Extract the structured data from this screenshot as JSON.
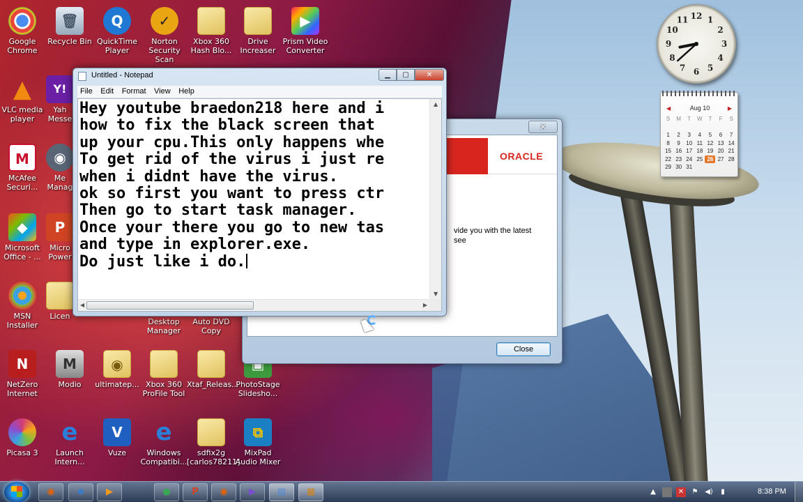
{
  "desktop": {
    "icons": [
      {
        "label": "Google Chrome",
        "icon": "chrome-icon",
        "glyph": "●",
        "color": "#e8453c"
      },
      {
        "label": "Recycle Bin",
        "icon": "recycle-bin-icon",
        "glyph": "🗑",
        "color": "#aab7c6"
      },
      {
        "label": "QuickTime Player",
        "icon": "quicktime-icon",
        "glyph": "Q",
        "color": "#1e78d4"
      },
      {
        "label": "Norton Security Scan",
        "icon": "norton-icon",
        "glyph": "✓",
        "color": "#e9a512"
      },
      {
        "label": "Xbox 360 Hash Blo...",
        "icon": "folder-icon",
        "glyph": "",
        "color": ""
      },
      {
        "label": "Drive Increaser",
        "icon": "folder-icon",
        "glyph": "",
        "color": ""
      },
      {
        "label": "Prism Video Converter",
        "icon": "prism-icon",
        "glyph": "▶",
        "color": "#7a4bd1"
      },
      {
        "label": "VLC media player",
        "icon": "vlc-icon",
        "glyph": "▲",
        "color": "#f08a10"
      },
      {
        "label": "Yah Messe",
        "icon": "yahoo-icon",
        "glyph": "Y!",
        "color": "#6a1fa5"
      },
      {
        "label": "McAfee Securi...",
        "icon": "mcafee-icon",
        "glyph": "M",
        "color": "#c8102e"
      },
      {
        "label": "Me Manag",
        "icon": "manager-icon",
        "glyph": "◉",
        "color": "#596575"
      },
      {
        "label": "Microsoft Office - ...",
        "icon": "office-icon",
        "glyph": "◆",
        "color": "#e05a1c"
      },
      {
        "label": "Micro Power",
        "icon": "powerpoint-icon",
        "glyph": "P",
        "color": "#d04423"
      },
      {
        "label": "MSN Installer",
        "icon": "msn-icon",
        "glyph": "✿",
        "color": "#3ba1e0"
      },
      {
        "label": "Licen",
        "icon": "folder-icon",
        "glyph": "",
        "color": ""
      },
      {
        "label": "NetZero Internet",
        "icon": "netzero-icon",
        "glyph": "N",
        "color": "#b81e1e"
      },
      {
        "label": "Modio",
        "icon": "modio-icon",
        "glyph": "M",
        "color": "#7d7d7d"
      },
      {
        "label": "ultimatep...",
        "icon": "firefox-folder-icon",
        "glyph": "",
        "color": ""
      },
      {
        "label": "Xbox 360 ProFile Tool",
        "icon": "folder-icon",
        "glyph": "",
        "color": ""
      },
      {
        "label": "Xtaf_Releas...",
        "icon": "folder-icon",
        "glyph": "",
        "color": ""
      },
      {
        "label": "PhotoStage Slidesho...",
        "icon": "photostage-icon",
        "glyph": "▣",
        "color": "#3d9a3d"
      },
      {
        "label": "Picasa 3",
        "icon": "picasa-icon",
        "glyph": "✺",
        "color": "#d33b7a"
      },
      {
        "label": "Launch Intern...",
        "icon": "ie-icon",
        "glyph": "e",
        "color": "#2c7fd8"
      },
      {
        "label": "Vuze",
        "icon": "vuze-icon",
        "glyph": "V",
        "color": "#1f5fbf"
      },
      {
        "label": "Windows Compatibi...",
        "icon": "ie-icon",
        "glyph": "e",
        "color": "#2c7fd8"
      },
      {
        "label": "sdfix2g [carlos78211]",
        "icon": "folder-icon",
        "glyph": "",
        "color": ""
      },
      {
        "label": "MixPad Audio Mixer",
        "icon": "mixpad-icon",
        "glyph": "⧉",
        "color": "#1b7fc4"
      },
      {
        "label": "Desktop Manager",
        "icon": "desktop-manager-icon",
        "glyph": "",
        "color": ""
      },
      {
        "label": "Auto DVD Copy",
        "icon": "dvd-copy-icon",
        "glyph": "",
        "color": ""
      }
    ]
  },
  "notepad": {
    "title": "Untitled - Notepad",
    "menu": [
      "File",
      "Edit",
      "Format",
      "View",
      "Help"
    ],
    "lines": [
      "Hey youtube braedon218 here and i",
      "how to fix the black screen that",
      "up your cpu.This only happens whe",
      "To get rid of the virus i just re",
      "when i didnt have the virus.",
      "ok so first you want to press ctr",
      "Then go to start task manager.",
      "Once your there you go to new tas",
      "and type in explorer.exe.",
      "Do just like i do."
    ]
  },
  "oracle": {
    "logo": "ORACLE",
    "text_line1": "vide you with the latest",
    "text_line2": "see",
    "close_label": "Close"
  },
  "gadgets": {
    "clock": {
      "hour": 8,
      "minute": 38
    },
    "calendar": {
      "month": "Aug 10",
      "days_header": [
        "S",
        "M",
        "T",
        "W",
        "T",
        "F",
        "S"
      ],
      "weeks": [
        [
          "",
          "",
          "",
          "",
          "",
          "",
          ""
        ],
        [
          "1",
          "2",
          "3",
          "4",
          "5",
          "6",
          "7"
        ],
        [
          "8",
          "9",
          "10",
          "11",
          "12",
          "13",
          "14"
        ],
        [
          "15",
          "16",
          "17",
          "18",
          "19",
          "20",
          "21"
        ],
        [
          "22",
          "23",
          "24",
          "25",
          "26",
          "27",
          "28"
        ],
        [
          "29",
          "30",
          "31",
          "",
          "",
          "",
          ""
        ]
      ],
      "today": "26"
    }
  },
  "taskbar": {
    "items": [
      {
        "name": "firefox",
        "glyph": "◉",
        "color": "#e66000"
      },
      {
        "name": "internet-explorer",
        "glyph": "e",
        "color": "#2c7fd8"
      },
      {
        "name": "media-player",
        "glyph": "▶",
        "color": "#f29a1b"
      },
      {
        "name": "chrome",
        "glyph": "●",
        "color": "#3aa757"
      },
      {
        "name": "powerpoint",
        "glyph": "P",
        "color": "#d04423"
      },
      {
        "name": "firefox-2",
        "glyph": "◉",
        "color": "#e66000"
      },
      {
        "name": "prism",
        "glyph": "▶",
        "color": "#7a4bd1"
      },
      {
        "name": "notepad",
        "glyph": "▤",
        "color": "#4c8bd8"
      },
      {
        "name": "java-installer",
        "glyph": "▦",
        "color": "#d0841c"
      }
    ],
    "time": "8:38 PM"
  }
}
